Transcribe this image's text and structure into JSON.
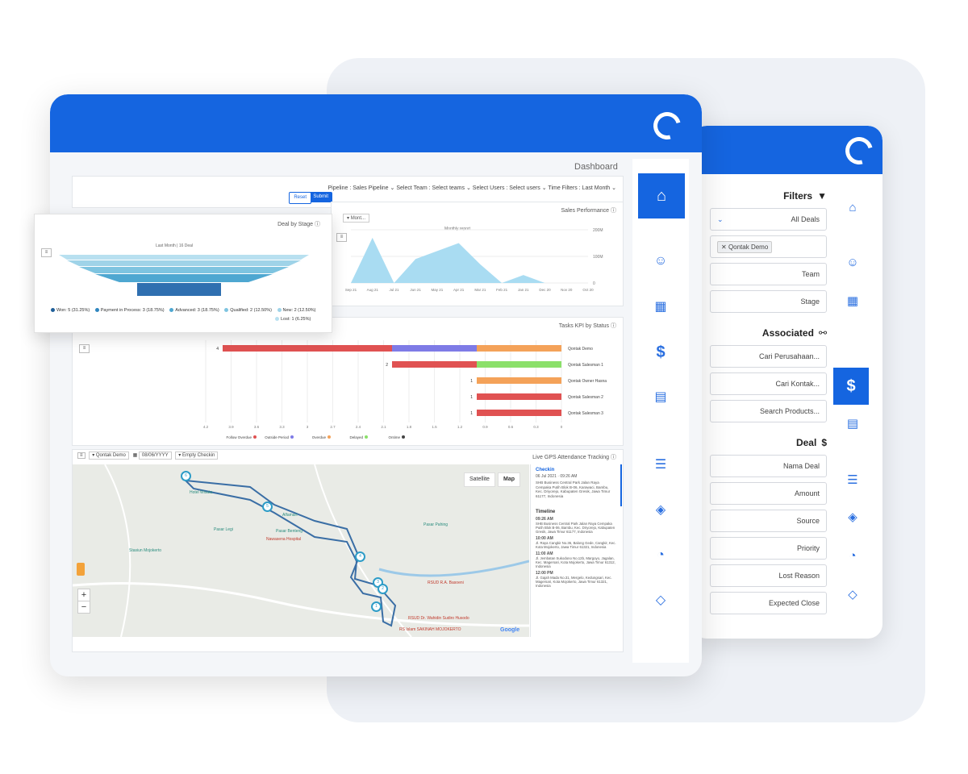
{
  "brand_color": "#1565e0",
  "back_window": {
    "filters_title": "Filters",
    "all_deals": "All Deals",
    "tag": "Qontak Demo",
    "team": "Team",
    "stage": "Stage",
    "associated_title": "Associated",
    "cari_perusahaan": "Cari Perusahaan...",
    "cari_kontak": "Cari Kontak...",
    "search_products": "Search Products...",
    "deal_title": "Deal",
    "nama_deal": "Nama Deal",
    "amount": "Amount",
    "source": "Source",
    "priority": "Priority",
    "lost_reason": "Lost Reason",
    "expected_close": "Expected Close",
    "nav_icons": [
      "home-icon",
      "people-icon",
      "building-icon",
      "dollar-icon",
      "calendar-icon",
      "list-icon",
      "layers-icon",
      "pie-icon",
      "tag-icon"
    ]
  },
  "front_window": {
    "page_title": "Dashboard",
    "filter_bar": {
      "text": "Pipeline : Sales Pipeline  ⌄  Select Team : Select teams ⌄   Select Users : Select users ⌄   Time Filters : Last Month ⌄",
      "submit": "Submit",
      "reset": "Reset"
    },
    "sales_performance": {
      "title": "Sales Performance ⓘ",
      "dropdown": "Mont...",
      "subtitle": "Monthly report"
    },
    "deal_by_stage": {
      "title": "Deal by Stage ⓘ",
      "subtitle": "Last Month | 16 Deal",
      "legend": [
        "New: 2 (12.50%)",
        "Qualified: 2 (12.50%)",
        "Advanced: 3 (18.75%)",
        "Payment in Process: 3 (18.75%)",
        "Won: 5 (31.25%)",
        "Lost: 1 (6.25%)"
      ],
      "legend_colors": [
        "#9fd3e8",
        "#7ec4e0",
        "#4ea7d1",
        "#2f86bf",
        "#1f5f99",
        "#9fd3e8"
      ]
    },
    "tasks_kpi": {
      "title": "Tasks KPI by Status ⓘ",
      "people": [
        "Qontak Demo",
        "Qontak Salesman 1",
        "Qontak Owner Hasna",
        "Qontak Salesman 2",
        "Qontak Salesman 3"
      ],
      "totals": [
        "4",
        "2",
        "1",
        "1",
        "1"
      ],
      "ticks": [
        "0",
        "0.3",
        "0.6",
        "0.9",
        "1.2",
        "1.5",
        "1.8",
        "2.1",
        "2.4",
        "2.7",
        "3",
        "3.3",
        "3.6",
        "3.9",
        "4.2"
      ],
      "legend": [
        "Ontime",
        "Delayed",
        "Overdue",
        "Outside Period",
        "Follow Overdue"
      ],
      "legend_colors": [
        "#444444",
        "#8be06a",
        "#f4a259",
        "#7e7be6",
        "#e05252"
      ]
    },
    "gps": {
      "title": "Live GPS Attendance Tracking ⓘ",
      "checkin_label": "Empty Checkin",
      "date": "08/06/YYYY",
      "user": "Qontak Demo",
      "map_btn": "Map",
      "satellite_btn": "Satellite",
      "checkin_title": "Checkin",
      "checkin_date": "06 Jul 2021",
      "checkin_time": "09:26 AM",
      "checkin_addr": "SHB Business Central Park Jalan Raya Cempaka Putih Blok B-06, Karawaci, Bambu, Kec. Driyorejo, Kabupaten Gresik, Jawa Timur 61177, Indonesia",
      "timeline_title": "Timeline",
      "timeline": [
        {
          "time": "09:26 AM",
          "addr": "SHB Business Central Park Jalan Raya Cempaka Putih Blok B-06, Bambu, Kec. Driyorejo, Kabupaten Gresik, Jawa Timur 61177, Indonesia"
        },
        {
          "time": "10:00 AM",
          "addr": "Jl. Raya Cangkir No.36, Balong Gede, Cangkir, Kec. Kota Mojokerto, Jawa Timur 61321, Indonesia"
        },
        {
          "time": "11:00 AM",
          "addr": "Jl. Jembatan Sukodono No.12b, Margoyo, Jagalan, Kec. Magersari, Kota Mojokerto, Jawa Timur 61312, Indonesia"
        },
        {
          "time": "12:00 PM",
          "addr": "Jl. Gajah Mada No.31, Mergelo, Kedungsari, Kec. Magersari, Kota Mojokerto, Jawa Timur 61321, Indonesia"
        }
      ],
      "pois": [
        "RSUD Dr. Wahidin Sudiro Husodo",
        "RS Islam SAKINAH MOJOKERTO",
        "Pasar Benteng",
        "Pasar Legi",
        "Alfamart",
        "Hotel Wisata",
        "Pasar Pahing",
        "Stasiun Mojokerto",
        "RSUD R.A. Basoeni",
        "Nawasena Hospital"
      ],
      "google": "Google"
    },
    "nav_icons": [
      "home-icon",
      "people-icon",
      "building-icon",
      "dollar-icon",
      "calendar-icon",
      "list-icon",
      "layers-icon",
      "pie-icon",
      "tag-icon"
    ]
  },
  "chart_data": [
    {
      "type": "area",
      "title": "Monthly report",
      "categories": [
        "Sep 21",
        "Aug 21",
        "Jul 21",
        "Jun 21",
        "May 21",
        "Apr 21",
        "Mar 21",
        "Feb 21",
        "Jan 21",
        "Dec 20",
        "Nov 20",
        "Oct 20"
      ],
      "values": [
        0,
        1700000,
        0,
        900000,
        1200000,
        1500000,
        700000,
        0,
        300000,
        0,
        0,
        0
      ],
      "y_ticks": [
        "0",
        "100M",
        "200M"
      ]
    },
    {
      "type": "bar",
      "title": "Tasks KPI by Status",
      "categories": [
        "Qontak Demo",
        "Qontak Salesman 1",
        "Qontak Owner Hasna",
        "Qontak Salesman 2",
        "Qontak Salesman 3"
      ],
      "series": [
        {
          "name": "Overdue",
          "values": [
            1,
            0,
            1,
            0,
            0
          ]
        },
        {
          "name": "Delayed",
          "values": [
            0,
            1,
            0,
            0,
            0
          ]
        },
        {
          "name": "Outside Period",
          "values": [
            1,
            0,
            0,
            0,
            0
          ]
        },
        {
          "name": "Follow Overdue",
          "values": [
            2,
            1,
            0,
            1,
            1
          ]
        }
      ]
    }
  ]
}
